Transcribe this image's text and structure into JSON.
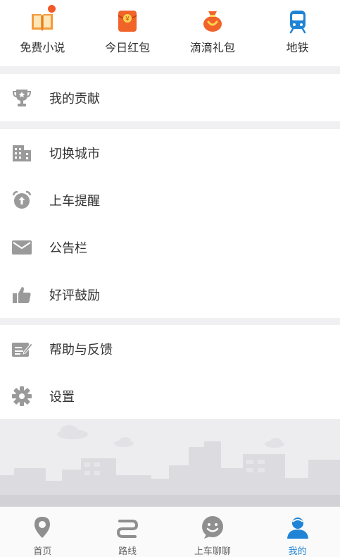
{
  "shortcuts": [
    {
      "label": "免费小说",
      "icon": "book-icon",
      "badge": true
    },
    {
      "label": "今日红包",
      "icon": "red-envelope-icon"
    },
    {
      "label": "滴滴礼包",
      "icon": "gift-bag-icon"
    },
    {
      "label": "地铁",
      "icon": "subway-icon"
    }
  ],
  "section1": [
    {
      "label": "我的贡献",
      "icon": "trophy-icon"
    }
  ],
  "section2": [
    {
      "label": "切换城市",
      "icon": "building-icon"
    },
    {
      "label": "上车提醒",
      "icon": "alarm-clock-icon"
    },
    {
      "label": "公告栏",
      "icon": "envelope-icon"
    },
    {
      "label": "好评鼓励",
      "icon": "thumbs-up-icon"
    }
  ],
  "section3": [
    {
      "label": "帮助与反馈",
      "icon": "feedback-edit-icon"
    },
    {
      "label": "设置",
      "icon": "gear-icon"
    }
  ],
  "tabbar": [
    {
      "label": "首页",
      "icon": "location-pin-icon"
    },
    {
      "label": "路线",
      "icon": "route-icon"
    },
    {
      "label": "上车聊聊",
      "icon": "chat-smile-icon"
    },
    {
      "label": "我的",
      "icon": "user-profile-icon",
      "active": true
    }
  ],
  "colors": {
    "accent": "#1f84d6",
    "icon_gray": "#9a9a9a",
    "badge_red": "#f05a2a",
    "orange": "#f0642a"
  }
}
